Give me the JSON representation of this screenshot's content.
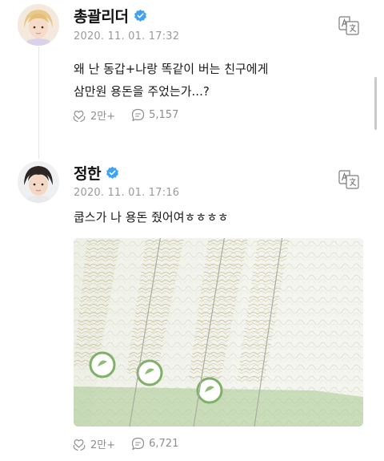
{
  "colors": {
    "verified_badge": "#3fa3f2",
    "timestamp": "#9a9a9a",
    "meta_text": "#8e8e8e",
    "note_green": "#8dbb78"
  },
  "posts": [
    {
      "author": "총괄리더",
      "verified_icon": "verified-badge-icon",
      "timestamp": "2020. 11. 01. 17:32",
      "text": "왜 난 동갑+나랑 똑같이 버는 친구에게\n삼만원 용돈을 주었는가...?",
      "translate_icon": "translate-icon",
      "likes_icon": "heart-hands-icon",
      "likes": "2만+",
      "comments_icon": "comment-icon",
      "comments": "5,157"
    },
    {
      "author": "정한",
      "verified_icon": "verified-badge-icon",
      "timestamp": "2020. 11. 01. 17:16",
      "text": "쿱스가 나 용돈 줬어여ㅎㅎㅎㅎ",
      "translate_icon": "translate-icon",
      "photo": "banknotes-photo",
      "likes_icon": "heart-hands-icon",
      "likes": "2만+",
      "comments_icon": "comment-icon",
      "comments": "6,721"
    }
  ]
}
